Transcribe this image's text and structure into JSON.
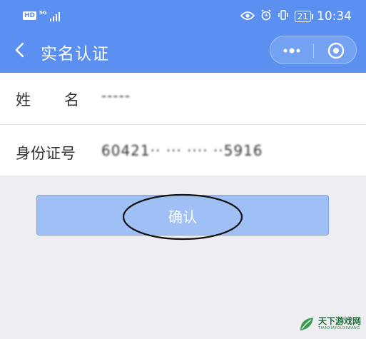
{
  "status_bar": {
    "network_badge": "HD",
    "network_type": "5G",
    "battery": "21",
    "time": "10:34"
  },
  "nav": {
    "title": "实名认证",
    "icons": [
      "back-arrow-icon",
      "more-dots-icon",
      "close-circle-icon"
    ]
  },
  "form": {
    "name_label": "姓名",
    "name_value": "-----",
    "id_label": "身份证号",
    "id_value": "60421·· ··· ····  ··5916"
  },
  "confirm": {
    "label": "确认"
  },
  "watermark": {
    "title": "天下游戏网",
    "subtitle": "TIANXIAYOUXIWANG"
  },
  "colors": {
    "header": "#5b8ff0",
    "button": "#a0bff5",
    "background": "#eeeef2"
  }
}
